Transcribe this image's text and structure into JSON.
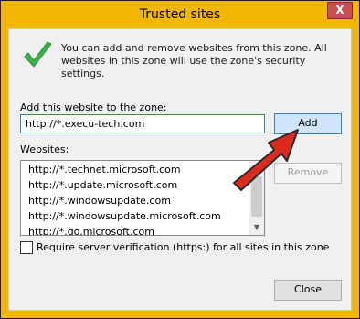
{
  "window": {
    "title": "Trusted sites",
    "close_symbol": "X"
  },
  "info_text": "You can add and remove websites from this zone. All websites in this zone will use the zone's security settings.",
  "add_label": "Add this website to the zone:",
  "url_input_value": "http://*.execu-tech.com",
  "add_button": "Add",
  "websites_label": "Websites:",
  "websites": [
    "http://*.technet.microsoft.com",
    "http://*.update.microsoft.com",
    "http://*.windowsupdate.com",
    "http://*.windowsupdate.microsoft.com",
    "http://*.go.microsoft.com"
  ],
  "remove_button": "Remove",
  "verify_label": "Require server verification (https:) for all sites in this zone",
  "verify_checked": false,
  "close_button": "Close",
  "colors": {
    "title_bar": "#f2b705",
    "arrow": "#dd2a1f",
    "check": "#3cb24a"
  },
  "icons": {
    "check": "green-checkmark-icon",
    "arrow": "red-arrow-annotation"
  }
}
